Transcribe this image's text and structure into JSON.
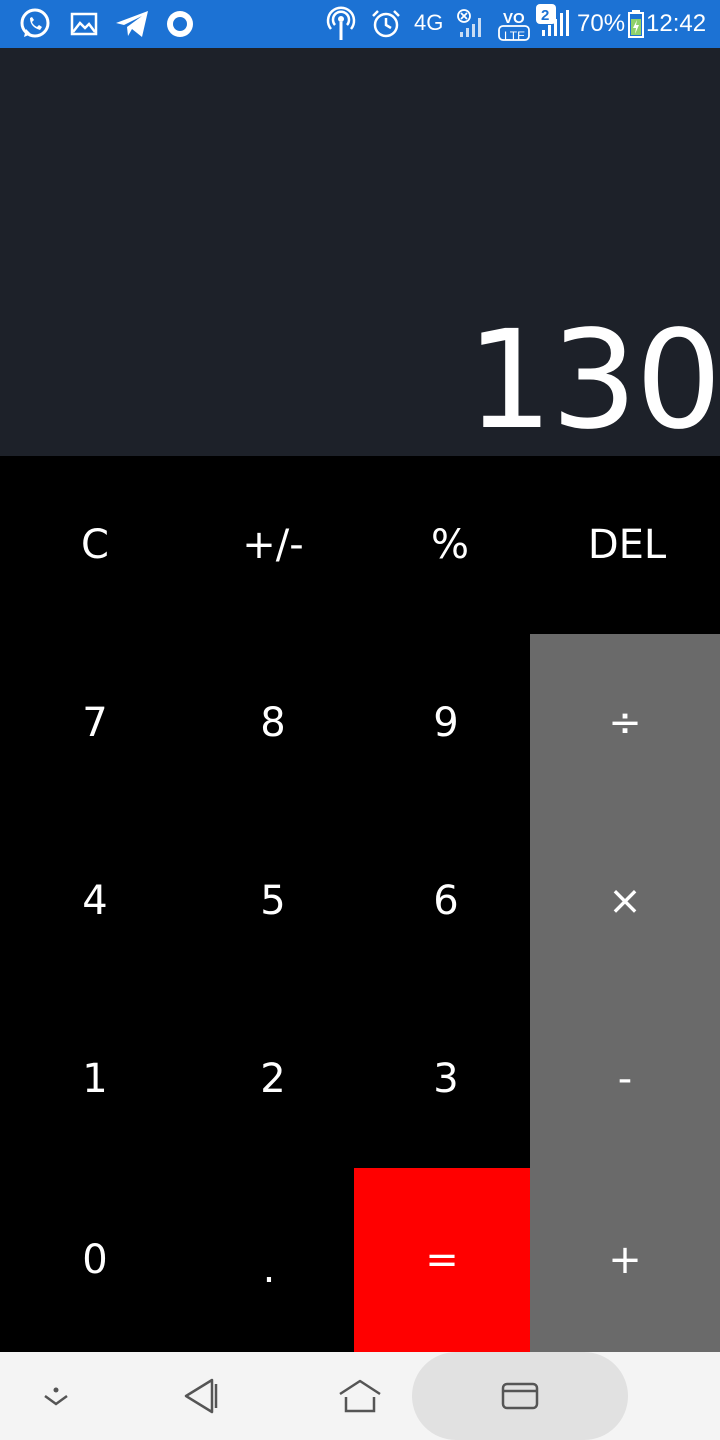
{
  "status_bar": {
    "network": "4G",
    "volte": "VO",
    "lte": "LTE",
    "sim_badge": "2",
    "battery": "70%",
    "time": "12:42",
    "left_icons": [
      "whatsapp-icon",
      "gallery-icon",
      "telegram-icon",
      "record-icon"
    ],
    "right_icons": [
      "hotspot-icon",
      "alarm-icon",
      "signal-icon",
      "battery-icon"
    ]
  },
  "display": {
    "value": "130"
  },
  "keys": {
    "clear": "C",
    "negate": "+/-",
    "percent": "%",
    "delete": "DEL",
    "seven": "7",
    "eight": "8",
    "nine": "9",
    "divide": "÷",
    "four": "4",
    "five": "5",
    "six": "6",
    "multiply": "×",
    "one": "1",
    "two": "2",
    "three": "3",
    "subtract": "-",
    "zero": "0",
    "decimal": ".",
    "equals": "=",
    "add": "+"
  },
  "colors": {
    "status_bar": "#1c72d4",
    "display_bg": "#1d2129",
    "keypad_bg": "#000000",
    "operator_bg": "#6a6a6a",
    "equals_bg": "#ff0000",
    "nav_bg": "#f4f4f4"
  },
  "nav_bar": {
    "icons": [
      "collapse-icon",
      "back-icon",
      "home-icon",
      "recents-icon"
    ]
  }
}
